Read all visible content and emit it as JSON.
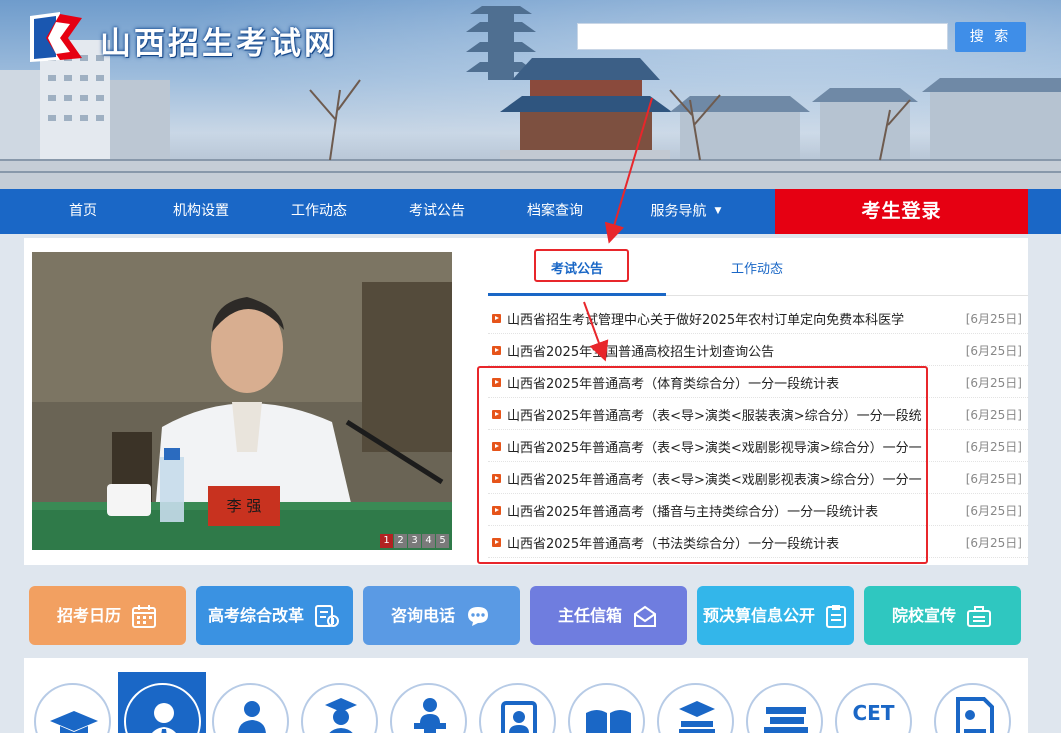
{
  "header": {
    "site_name": "山西招生考试网",
    "search": {
      "placeholder": "",
      "button_label": "搜 索"
    }
  },
  "nav": {
    "items": [
      "首页",
      "机构设置",
      "工作动态",
      "考试公告",
      "档案查询",
      "服务导航"
    ],
    "login_label": "考生登录"
  },
  "slideshow": {
    "nameplate": "李 强",
    "pages": [
      "1",
      "2",
      "3",
      "4",
      "5"
    ],
    "active_page": "1"
  },
  "news": {
    "tabs": [
      "考试公告",
      "工作动态"
    ],
    "active_tab": "考试公告",
    "items": [
      {
        "title": "山西省招生考试管理中心关于做好2025年农村订单定向免费本科医学",
        "date": "[6月25日]"
      },
      {
        "title": "山西省2025年全国普通高校招生计划查询公告",
        "date": "[6月25日]"
      },
      {
        "title": "山西省2025年普通高考（体育类综合分）一分一段统计表",
        "date": "[6月25日]"
      },
      {
        "title": "山西省2025年普通高考（表<导>演类<服装表演>综合分）一分一段统",
        "date": "[6月25日]"
      },
      {
        "title": "山西省2025年普通高考（表<导>演类<戏剧影视导演>综合分）一分一",
        "date": "[6月25日]"
      },
      {
        "title": "山西省2025年普通高考（表<导>演类<戏剧影视表演>综合分）一分一",
        "date": "[6月25日]"
      },
      {
        "title": "山西省2025年普通高考（播音与主持类综合分）一分一段统计表",
        "date": "[6月25日]"
      },
      {
        "title": "山西省2025年普通高考（书法类综合分）一分一段统计表",
        "date": "[6月25日]"
      }
    ]
  },
  "quick_tiles": [
    {
      "label": "招考日历",
      "color": "#f2a061",
      "icon": "calendar-icon"
    },
    {
      "label": "高考综合改革",
      "color": "#3a92e2",
      "icon": "reform-icon"
    },
    {
      "label": "咨询电话",
      "color": "#5a9ae4",
      "icon": "chat-icon"
    },
    {
      "label": "主任信箱",
      "color": "#6f7ddf",
      "icon": "mail-icon"
    },
    {
      "label": "预决算信息公开",
      "color": "#33b6ea",
      "icon": "clipboard-icon"
    },
    {
      "label": "院校宣传",
      "color": "#2fc7c0",
      "icon": "briefcase-icon"
    }
  ],
  "service_icons": [
    {
      "icon": "graduation-cap-icon"
    },
    {
      "icon": "person-tie-icon"
    },
    {
      "icon": "person-laptop-icon"
    },
    {
      "icon": "graduate-student-icon"
    },
    {
      "icon": "speaker-podium-icon"
    },
    {
      "icon": "id-card-icon"
    },
    {
      "icon": "open-book-icon"
    },
    {
      "icon": "cap-books-icon"
    },
    {
      "icon": "books-stack-icon"
    },
    {
      "icon": "cet-icon",
      "text": "CET"
    },
    {
      "icon": "profile-document-icon"
    }
  ],
  "colors": {
    "nav_blue": "#1a67c6",
    "login_red": "#e60012",
    "annotation_red": "#e8262b",
    "bullet_orange": "#e6541a"
  }
}
